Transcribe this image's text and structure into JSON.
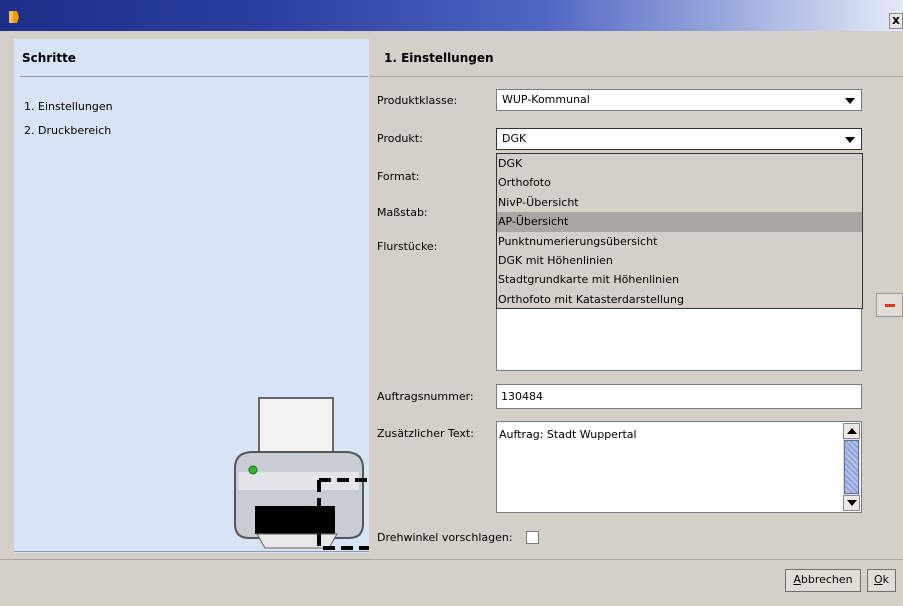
{
  "titlebar": {
    "close_label": "x"
  },
  "left": {
    "title": "Schritte",
    "steps": [
      "1. Einstellungen",
      "2. Druckbereich"
    ]
  },
  "right": {
    "title": "1. Einstellungen",
    "labels": {
      "produktklasse": "Produktklasse:",
      "produkt": "Produkt:",
      "format": "Format:",
      "massstab": "Maßstab:",
      "flurstuecke": "Flurstücke:",
      "auftragsnummer": "Auftragsnummer:",
      "zusatztext": "Zusätzlicher Text:",
      "drehwinkel": "Drehwinkel vorschlagen:"
    },
    "produktklasse_value": "WUP-Kommunal",
    "produkt_value": "DGK",
    "dropdown_options": [
      "DGK",
      "Orthofoto",
      "NivP-Übersicht",
      "AP-Übersicht",
      "Punktnumerierungsübersicht",
      "DGK mit Höhenlinien",
      "Stadtgrundkarte mit Höhenlinien",
      "Orthofoto mit Katasterdarstellung"
    ],
    "dropdown_highlighted": "AP-Übersicht",
    "auftragsnummer_value": "130484",
    "zusatztext_value": "Auftrag: Stadt Wuppertal"
  },
  "buttons": {
    "cancel_first": "A",
    "cancel_rest": "bbrechen",
    "ok_first": "O",
    "ok_rest": "k"
  },
  "colors": {
    "title_gradient_start": "#1c2f88",
    "left_panel_bg": "#d7e4f5",
    "window_bg": "#d4d0c8",
    "highlight": "#a9a6a1",
    "remove_icon": "#e0391b"
  }
}
